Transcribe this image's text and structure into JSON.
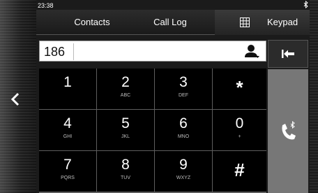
{
  "status": {
    "time": "23:38",
    "bluetooth_icon": "bluetooth-icon"
  },
  "tabs": [
    {
      "label": "Contacts"
    },
    {
      "label": "Call Log"
    },
    {
      "label": "Keypad",
      "icon": "keypad-grid-icon",
      "active": true
    }
  ],
  "number_field": {
    "value": "186",
    "icon": "contact-person-icon"
  },
  "backspace": {
    "icon": "backspace-arrow-icon"
  },
  "keys": [
    {
      "digit": "1",
      "letters": ""
    },
    {
      "digit": "2",
      "letters": "ABC"
    },
    {
      "digit": "3",
      "letters": "DEF"
    },
    {
      "digit": "*",
      "letters": ""
    },
    {
      "digit": "4",
      "letters": "GHI"
    },
    {
      "digit": "5",
      "letters": "JKL"
    },
    {
      "digit": "6",
      "letters": "MNO"
    },
    {
      "digit": "0",
      "letters": "+"
    },
    {
      "digit": "7",
      "letters": "PQRS"
    },
    {
      "digit": "8",
      "letters": "TUV"
    },
    {
      "digit": "9",
      "letters": "WXYZ"
    },
    {
      "digit": "#",
      "letters": ""
    }
  ],
  "call_button": {
    "icon": "bluetooth-call-icon"
  },
  "back_button": {
    "icon": "chevron-left-icon"
  },
  "colors": {
    "key_bg": "#000000",
    "grid_bg": "#5e5e5e",
    "call_bg": "#777777"
  }
}
